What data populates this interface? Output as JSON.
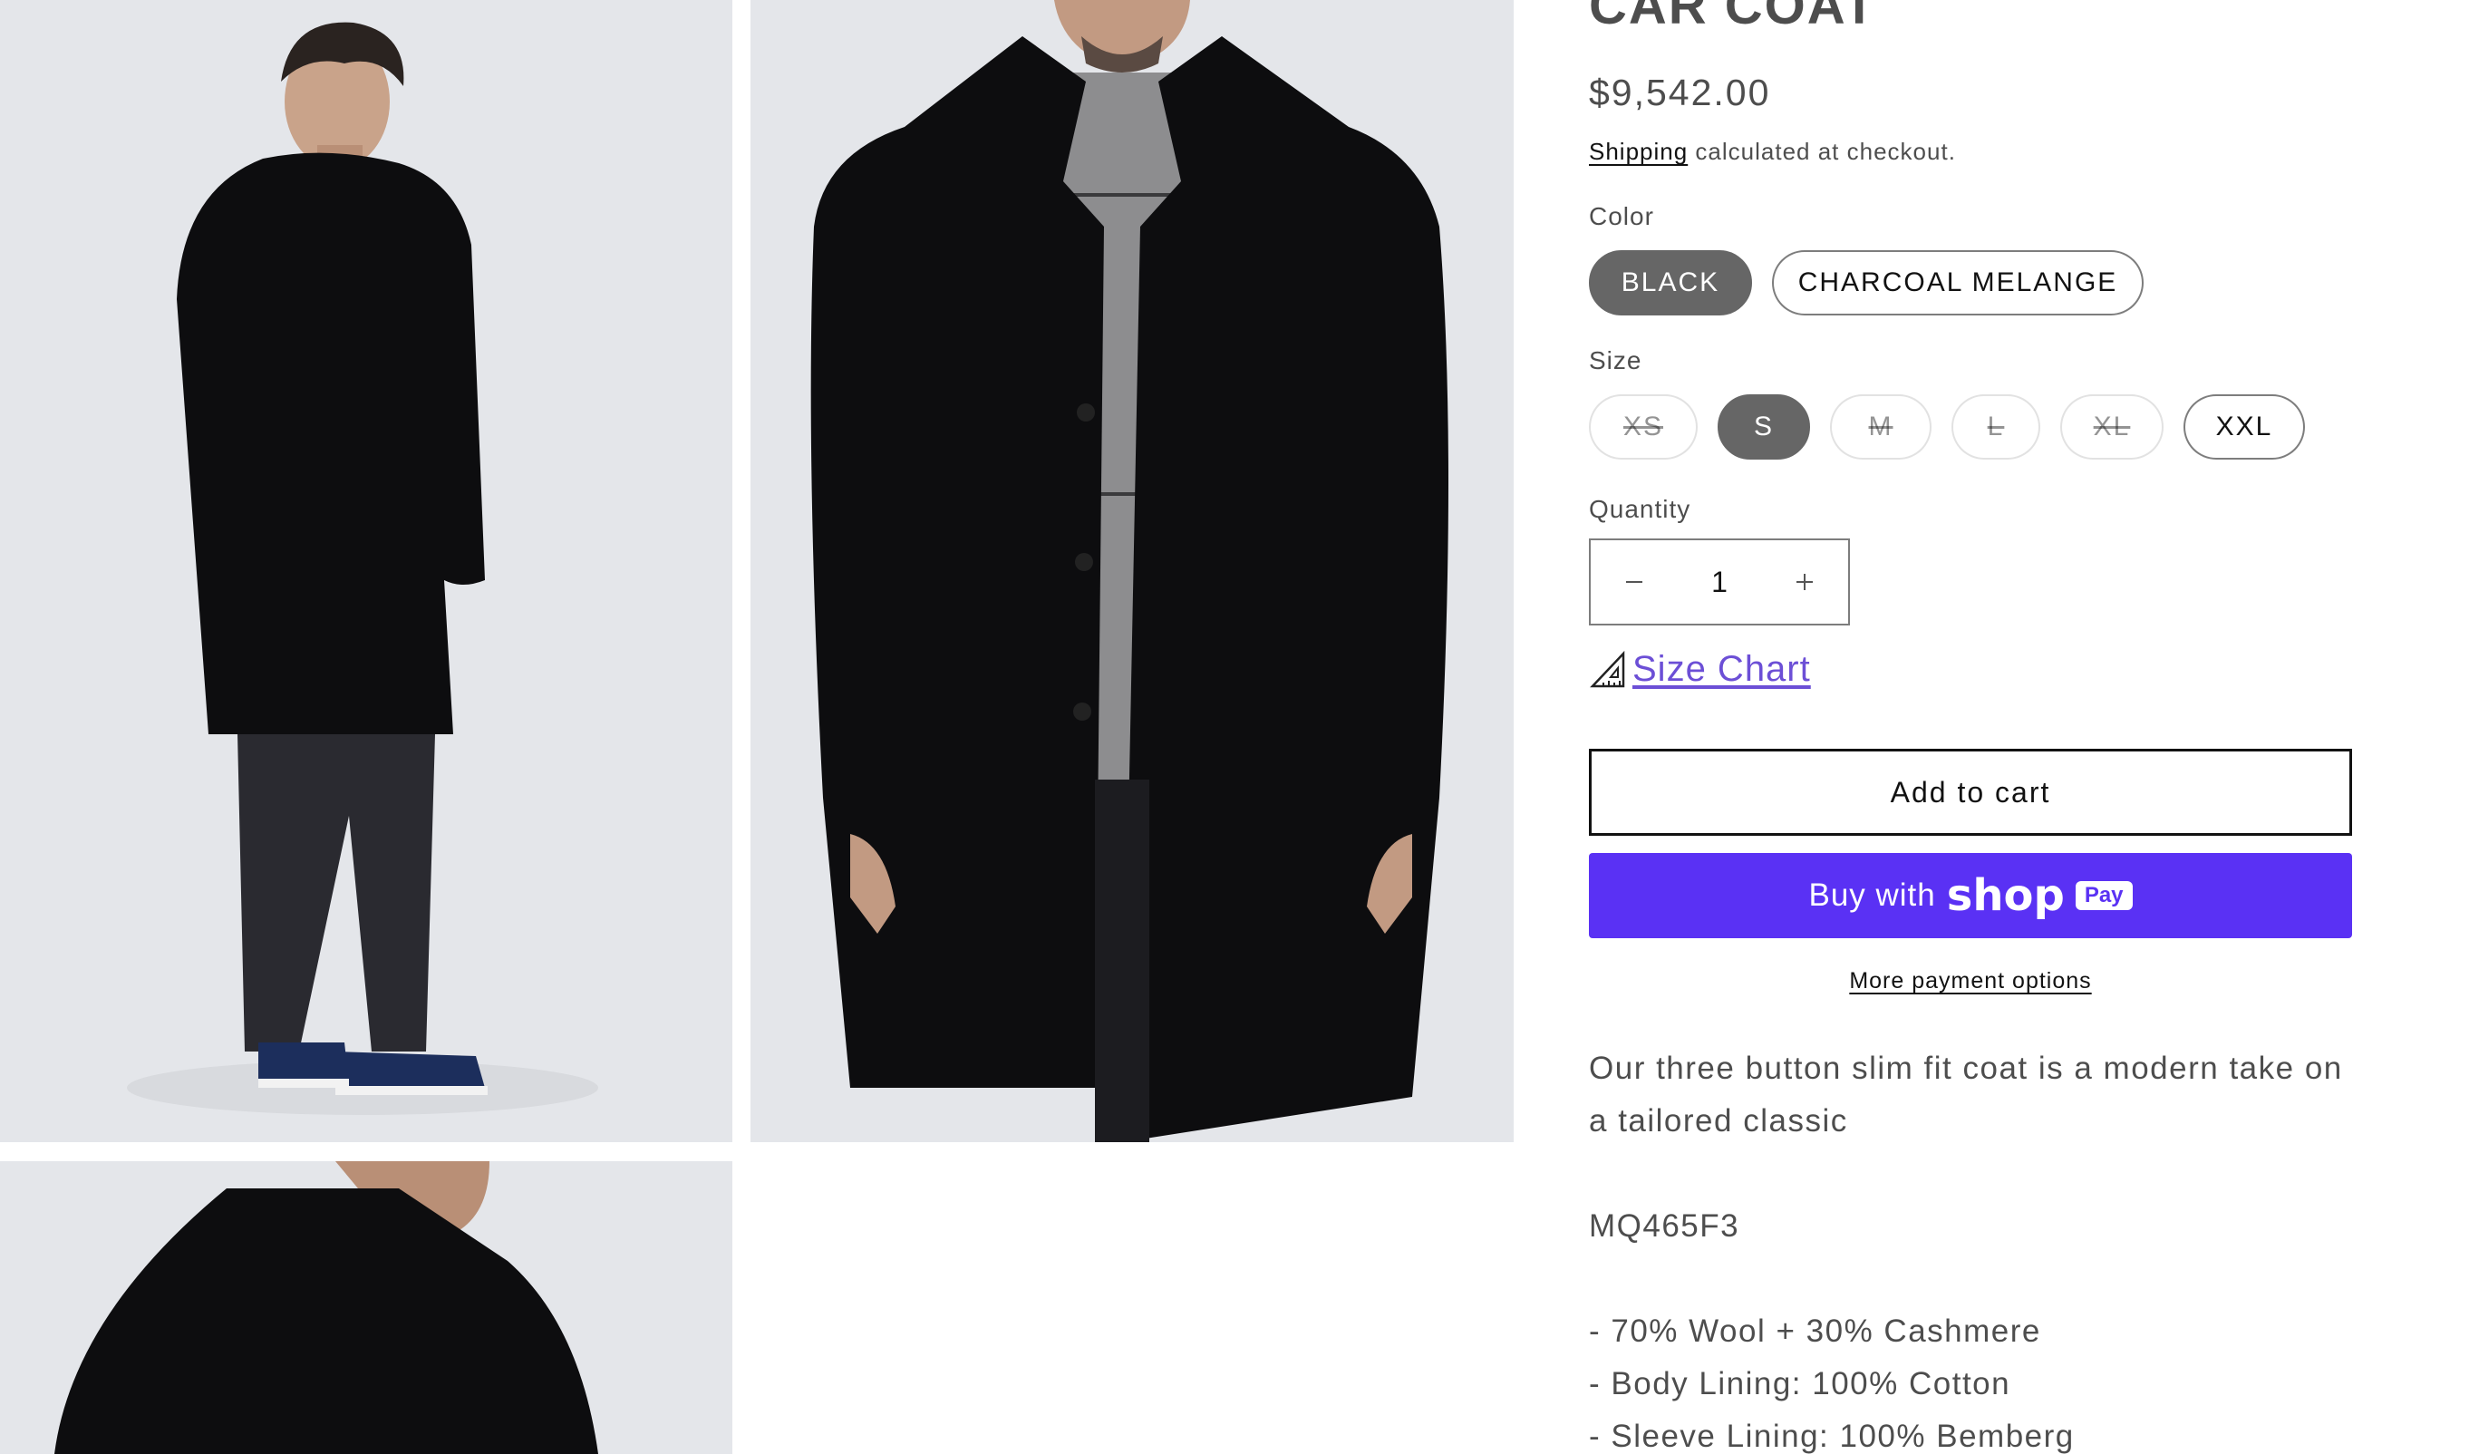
{
  "product": {
    "title": "CAR COAT",
    "price": "$9,542.00",
    "shipping_link": "Shipping",
    "shipping_suffix": " calculated at checkout."
  },
  "options": {
    "color_label": "Color",
    "colors": [
      {
        "label": "BLACK",
        "selected": true,
        "available": true
      },
      {
        "label": "CHARCOAL MELANGE",
        "selected": false,
        "available": true
      }
    ],
    "size_label": "Size",
    "sizes": [
      {
        "label": "XS",
        "selected": false,
        "available": false
      },
      {
        "label": "S",
        "selected": true,
        "available": true
      },
      {
        "label": "M",
        "selected": false,
        "available": false
      },
      {
        "label": "L",
        "selected": false,
        "available": false
      },
      {
        "label": "XL",
        "selected": false,
        "available": false
      },
      {
        "label": "XXL",
        "selected": false,
        "available": true
      }
    ]
  },
  "quantity": {
    "label": "Quantity",
    "value": "1",
    "decrease_icon": "minus-icon",
    "increase_icon": "plus-icon"
  },
  "size_chart": {
    "icon": "ruler-triangle-icon",
    "label": "Size Chart"
  },
  "actions": {
    "add_to_cart": "Add to cart",
    "buy_with": "Buy with",
    "shop_word": "shop",
    "pay_badge": "Pay",
    "more_payment": "More payment options"
  },
  "description": {
    "intro": "Our three button slim fit coat is a modern take on a tailored classic",
    "sku": "MQ465F3",
    "details": [
      "- 70% Wool + 30% Cashmere",
      "- Body Lining: 100% Cotton",
      "- Sleeve Lining: 100% Bemberg"
    ]
  },
  "colors": {
    "accent_link": "#6c4fd6",
    "shop_pay": "#5a31f4",
    "selected_pill": "#666666",
    "coat": "#0d0d0f",
    "photo_background": "#e6e7ea"
  }
}
